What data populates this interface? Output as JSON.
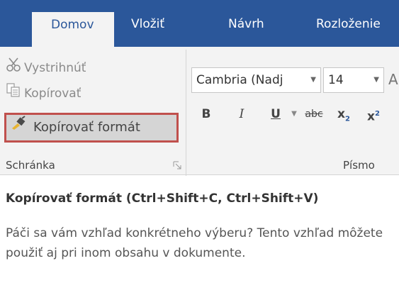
{
  "tabs": [
    {
      "label": "Domov",
      "active": true
    },
    {
      "label": "Vložiť"
    },
    {
      "label": "Návrh"
    },
    {
      "label": "Rozloženie"
    }
  ],
  "clipboard": {
    "cut_label": "Vystrihnúť",
    "copy_label": "Kopírovať",
    "format_painter_label": "Kopírovať formát",
    "group_label": "Schránka"
  },
  "font": {
    "font_name": "Cambria (Nadj",
    "font_size": "14",
    "bold": "B",
    "italic": "I",
    "underline": "U",
    "strike": "abc",
    "subscript": "x",
    "subscript_sub": "2",
    "superscript": "x",
    "superscript_sup": "2",
    "partial": "A",
    "group_label": "Písmo"
  },
  "tooltip": {
    "title": "Kopírovať formát (Ctrl+Shift+C, Ctrl+Shift+V)",
    "body": "Páči sa vám vzhľad konkrétneho výberu? Tento vzhľad môžete použiť aj pri inom obsahu v dokumente."
  },
  "colors": {
    "accent": "#2b579a",
    "highlight_border": "#c0504d",
    "ribbon_bg": "#f3f3f3"
  }
}
